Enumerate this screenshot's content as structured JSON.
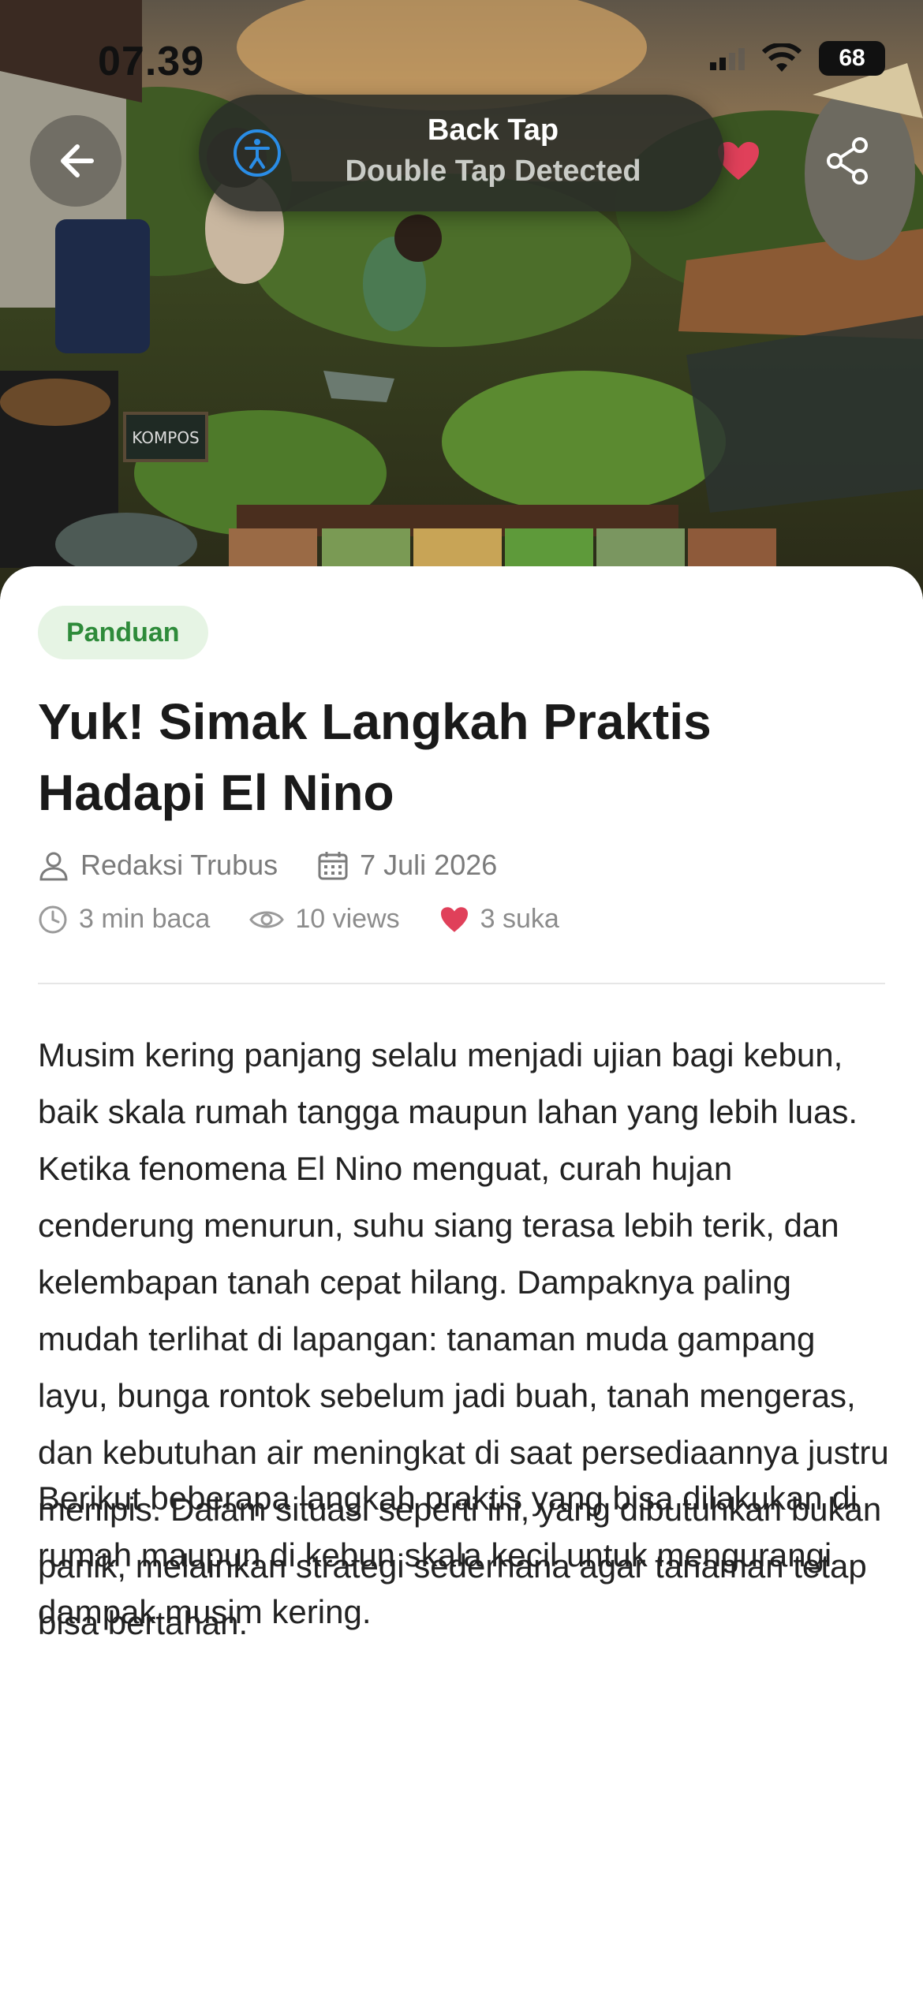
{
  "status_bar": {
    "time": "07.39",
    "battery": "68"
  },
  "toast": {
    "title": "Back Tap",
    "subtitle": "Double Tap Detected"
  },
  "hero": {
    "chalkboard_label": "KOMPOS"
  },
  "article": {
    "category": "Panduan",
    "title": "Yuk! Simak Langkah Praktis Hadapi El Nino",
    "author": "Redaksi Trubus",
    "date": "7 Juli 2026",
    "read_time": "3 min baca",
    "views": "10 views",
    "likes": "3 suka",
    "paragraphs": [
      "Musim kering panjang selalu menjadi ujian bagi kebun, baik skala rumah tangga maupun lahan yang lebih luas. Ketika fenomena El Nino menguat, curah hujan cenderung menurun, suhu siang terasa lebih terik, dan kelembapan tanah cepat hilang. Dampaknya paling mudah terlihat di lapangan: tanaman muda gampang layu, bunga rontok sebelum jadi buah, tanah mengeras, dan kebutuhan air meningkat di saat persediaannya justru menipis. Dalam situasi seperti ini, yang dibutuhkan bukan panik, melainkan strategi sederhana agar tanaman tetap bisa bertahan.",
      "Berikut beberapa langkah praktis yang bisa dilakukan di rumah maupun di kebun skala kecil untuk mengurangi dampak musim kering."
    ]
  },
  "colors": {
    "accent_green": "#2e8b3a",
    "chip_bg": "#e6f4e4",
    "like_red": "#e0405a"
  },
  "icons": [
    "back-arrow-icon",
    "accessibility-icon",
    "heart-icon",
    "share-icon",
    "user-icon",
    "calendar-icon",
    "clock-icon",
    "eye-icon",
    "signal-icon",
    "wifi-icon"
  ]
}
